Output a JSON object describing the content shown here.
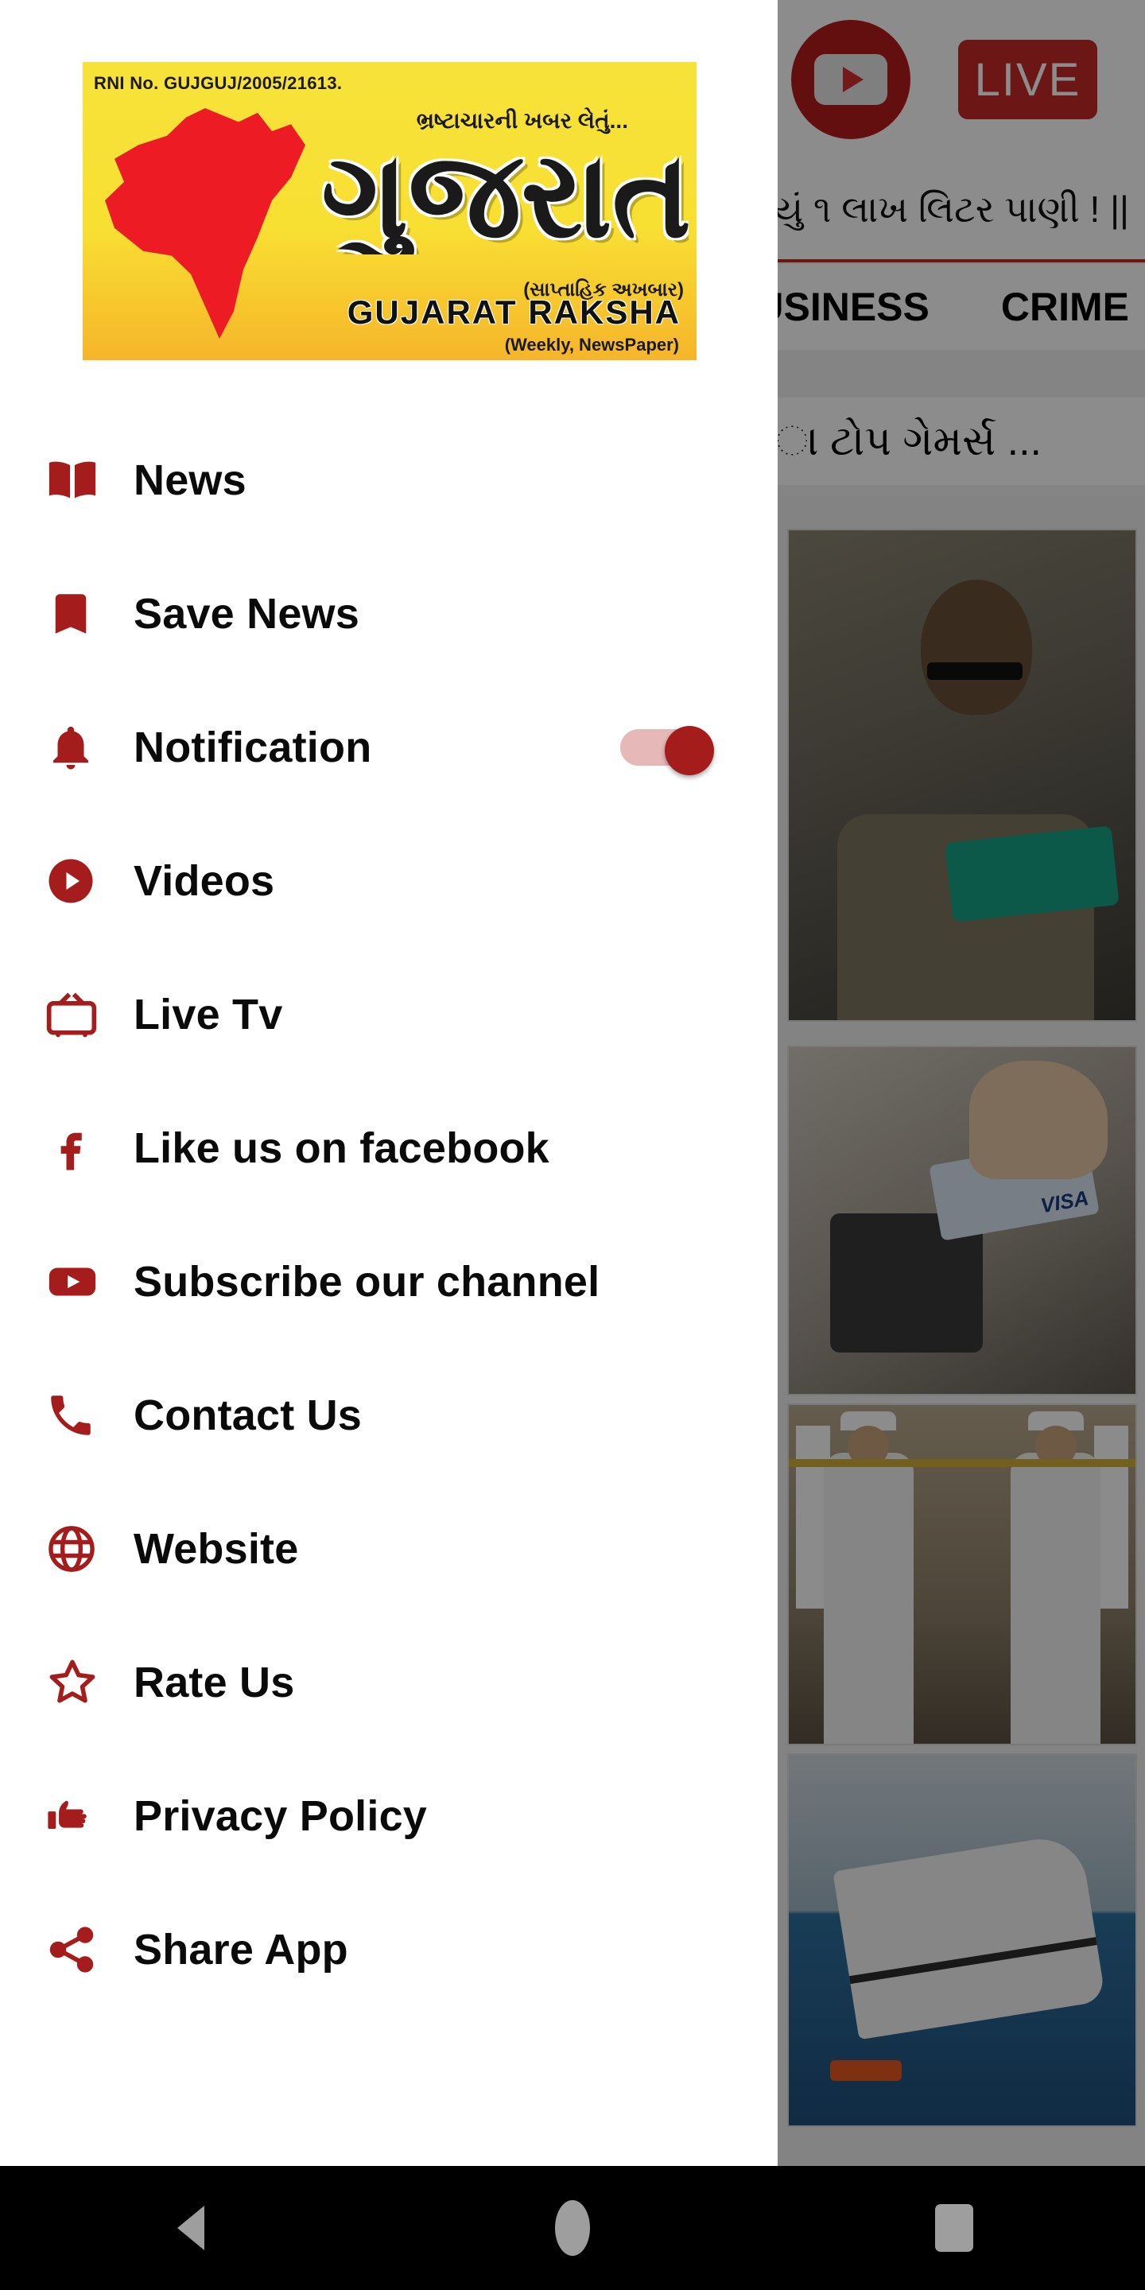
{
  "background": {
    "youtube_icon": "youtube-play-icon",
    "live_label": "LIVE",
    "ticker_text": "યું ૧ લાખ લિટર પાણી !   ||",
    "tabs": [
      "BUSINESS",
      "CRIME"
    ],
    "headline": "ા ટોપ ગેમર્સ ...",
    "cards": [
      {
        "name": "card-gaming"
      },
      {
        "name": "card-payment"
      },
      {
        "name": "card-navy"
      },
      {
        "name": "card-ship"
      }
    ]
  },
  "drawer": {
    "logo": {
      "rni": "RNI No. GUJGUJ/2005/21613.",
      "tagline": "ભ્રષ્ટાચારની ખબર લેતું...",
      "title": "ગુજરાત રક્ષા",
      "weekly_gujarati": "(સાપ્તાહિક અખબાર)",
      "name_english": "GUJARAT RAKSHA",
      "subtitle_english": "(Weekly, NewsPaper)",
      "accent_yellow": "#f7e23a",
      "accent_red": "#ed1c24"
    },
    "accent_color": "#a51c1c",
    "items": [
      {
        "label": "News",
        "icon": "book-open-icon",
        "toggle": null
      },
      {
        "label": "Save News",
        "icon": "bookmark-icon",
        "toggle": null
      },
      {
        "label": "Notification",
        "icon": "bell-icon",
        "toggle": "on"
      },
      {
        "label": "Videos",
        "icon": "play-circle-icon",
        "toggle": null
      },
      {
        "label": "Live Tv",
        "icon": "tv-icon",
        "toggle": null
      },
      {
        "label": "Like us on facebook",
        "icon": "facebook-icon",
        "toggle": null
      },
      {
        "label": "Subscribe our channel",
        "icon": "youtube-icon",
        "toggle": null
      },
      {
        "label": "Contact Us",
        "icon": "phone-icon",
        "toggle": null
      },
      {
        "label": "Website",
        "icon": "globe-icon",
        "toggle": null
      },
      {
        "label": "Rate Us",
        "icon": "star-outline-icon",
        "toggle": null
      },
      {
        "label": "Privacy Policy",
        "icon": "pointing-hand-icon",
        "toggle": null
      },
      {
        "label": "Share App",
        "icon": "share-icon",
        "toggle": null
      }
    ]
  },
  "system_nav": {
    "back": "back-triangle-icon",
    "home": "home-circle-icon",
    "recents": "recents-square-icon"
  }
}
